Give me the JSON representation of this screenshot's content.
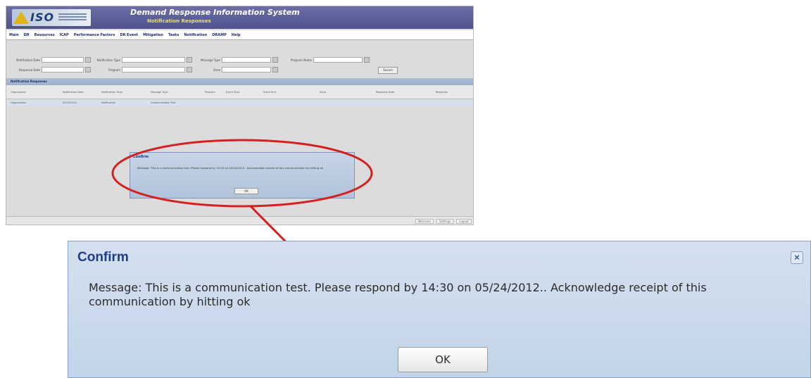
{
  "app": {
    "logo_text": "ISO",
    "title": "Demand Response Information System",
    "subtitle": "Notification Responses",
    "menu": [
      "Main",
      "DR",
      "Resources",
      "ICAP",
      "Performance Factors",
      "DR Event",
      "Mitigation",
      "Tasks",
      "Notification",
      "DRAMP",
      "Help"
    ],
    "filters": [
      "Notification Date",
      "Notification Type",
      "Message Type",
      "Program Name",
      "Response Date",
      "Program",
      "Zone"
    ],
    "search_label": "Search",
    "table_title": "Notification Responses",
    "table_headers": [
      "Organization",
      "Notification Date",
      "Notification Time",
      "Message Type",
      "Program",
      "Event Start",
      "Event End",
      "Zone",
      "Response Date",
      "Response"
    ],
    "table_row": [
      "Organization",
      "05/24/2012",
      "Notification",
      "Communication Test",
      "",
      "",
      "",
      "",
      "",
      ""
    ],
    "status_items": [
      "Welcome",
      "Settings",
      "Logout"
    ]
  },
  "mini_dialog": {
    "title": "Confirm",
    "message": "Message: This is a communication test. Please respond by 14:30 on 05/24/2012.. Acknowledge receipt of this communication by hitting ok",
    "ok_label": "OK"
  },
  "confirm_dialog": {
    "title": "Confirm",
    "message": "Message: This is a communication test. Please respond by 14:30 on 05/24/2012.. Acknowledge receipt of this communication by hitting ok",
    "ok_label": "OK",
    "close_glyph": "×"
  },
  "colors": {
    "header": "#4f538c",
    "dialog_title": "#1e3f86",
    "callout": "#d42020"
  }
}
